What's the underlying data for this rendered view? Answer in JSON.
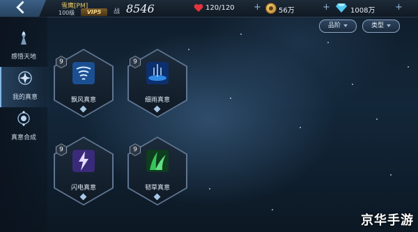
{
  "header": {
    "player_name": "雪鹰[PM]",
    "player_level": "100级",
    "vip": "VIP5",
    "power_label": "战",
    "power_value": "8546"
  },
  "resources": {
    "stamina": "120/120",
    "coins": "56万",
    "diamonds": "1008万",
    "add_symbol": "+"
  },
  "sidebar": {
    "items": [
      {
        "label": "感悟天地",
        "icon": "spirit-statue-icon"
      },
      {
        "label": "我的真意",
        "icon": "intent-orb-icon",
        "active": true
      },
      {
        "label": "真意合成",
        "icon": "synthesis-icon"
      }
    ]
  },
  "filters": {
    "quality_label": "品阶",
    "type_label": "类型"
  },
  "cards": [
    {
      "level": "9",
      "name": "飘风真意",
      "icon": "whirlwind-icon",
      "color": "#6fb6ff"
    },
    {
      "level": "9",
      "name": "细雨真意",
      "icon": "rain-icon",
      "color": "#3aa0ff"
    },
    {
      "level": "9",
      "name": "闪电真意",
      "icon": "lightning-icon",
      "color": "#b79cff"
    },
    {
      "level": "9",
      "name": "韧草真意",
      "icon": "grass-icon",
      "color": "#37c25a"
    }
  ],
  "watermark": "京华手游"
}
